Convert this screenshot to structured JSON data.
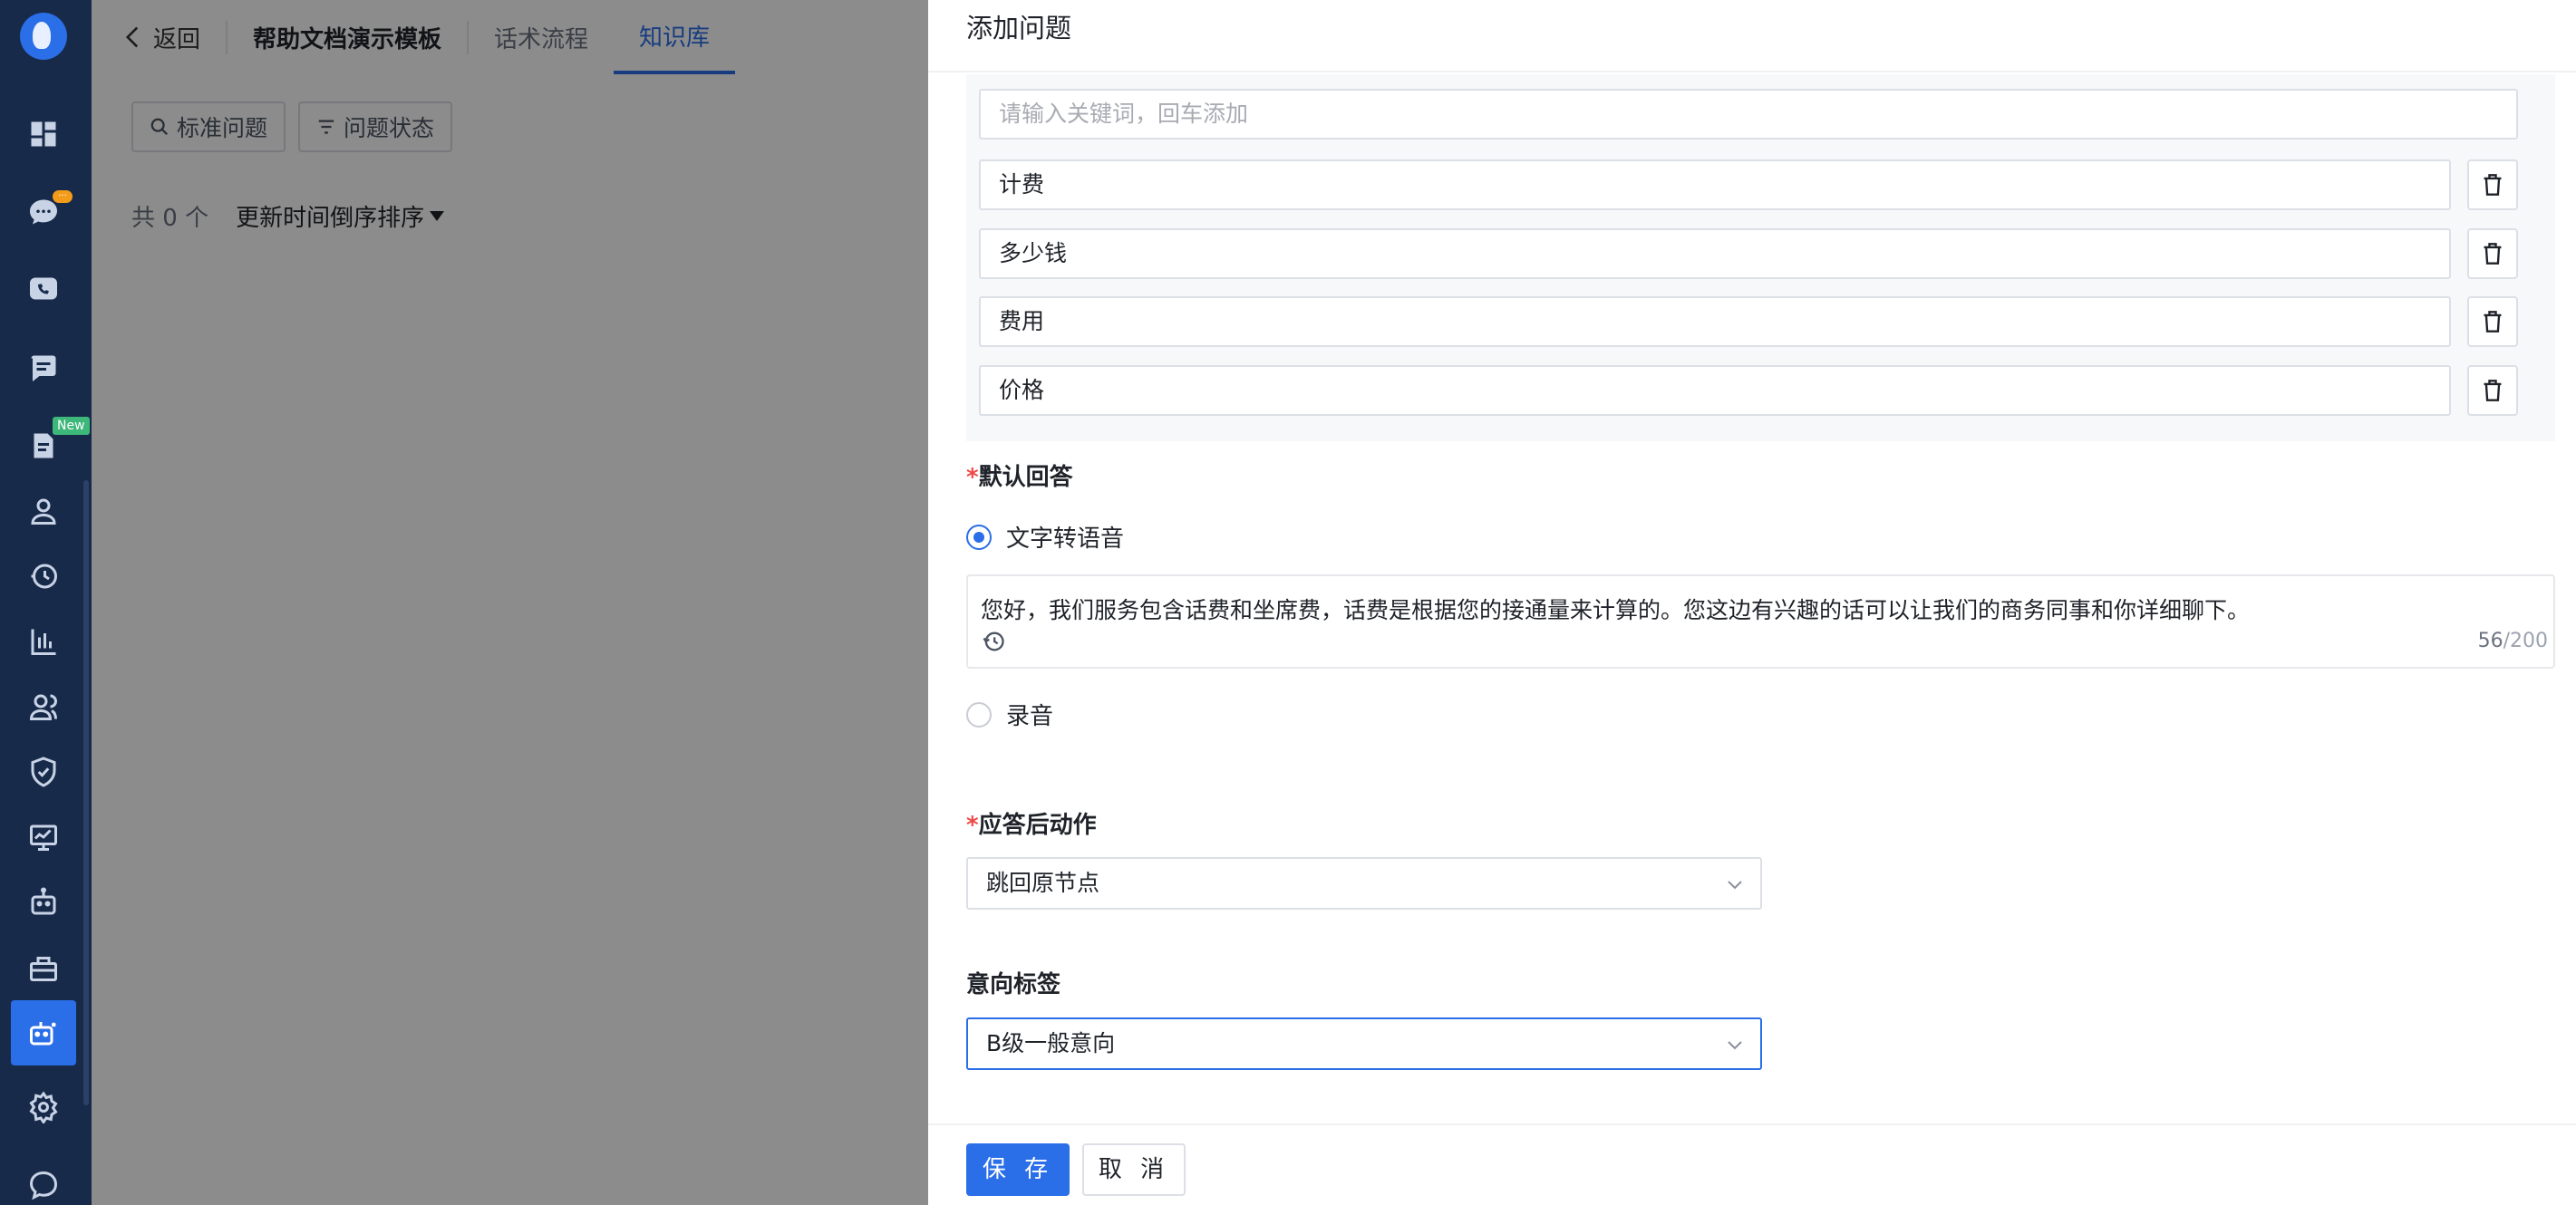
{
  "nav": {
    "badge_new": "New",
    "items": [
      "dashboard-icon",
      "chat-icon",
      "phone-icon",
      "message-icon",
      "document-icon",
      "user-icon",
      "history-icon",
      "chart-icon",
      "team-icon",
      "shield-icon",
      "monitor-icon",
      "robot-icon",
      "toolbox-icon",
      "robot-active-icon",
      "gear-icon",
      "wechat-icon"
    ]
  },
  "topbar": {
    "back_label": "返回",
    "template_title": "帮助文档演示模板",
    "tabs": [
      {
        "label": "话术流程",
        "active": false
      },
      {
        "label": "知识库",
        "active": true
      }
    ]
  },
  "filters": {
    "standard_question": "标准问题",
    "question_status": "问题状态"
  },
  "list": {
    "count_text": "共 0 个",
    "sort_label": "更新时间倒序排序"
  },
  "drawer": {
    "title": "添加问题",
    "keyword_placeholder": "请输入关键词，回车添加",
    "keywords": [
      "计费",
      "多少钱",
      "费用",
      "价格"
    ],
    "default_answer": {
      "label": "默认回答",
      "option_tts": "文字转语音",
      "option_recording": "录音",
      "selected": "文字转语音",
      "text": "您好，我们服务包含话费和坐席费，话费是根据您的接通量来计算的。您这边有兴趣的话可以让我们的商务同事和你详细聊下。",
      "count": "56",
      "max": "/200"
    },
    "post_action": {
      "label": "应答后动作",
      "value": "跳回原节点"
    },
    "intent_tag": {
      "label": "意向标签",
      "value": "B级一般意向"
    },
    "save_label": "保 存",
    "cancel_label": "取 消"
  },
  "colors": {
    "accent": "#2a6ee8",
    "nav_bg": "#182a4a",
    "required": "#f04848"
  }
}
